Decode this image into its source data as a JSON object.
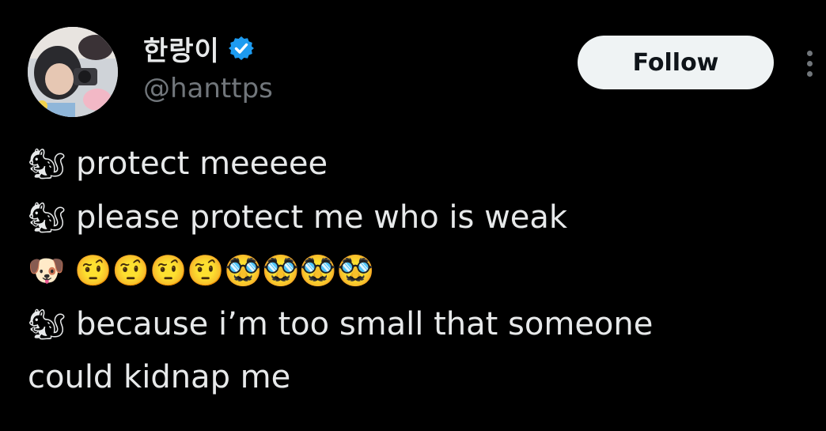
{
  "author": {
    "display_name": "한랑이",
    "handle": "@hanttps",
    "verified": true,
    "verified_color": "#1d9bf0"
  },
  "actions": {
    "follow_label": "Follow",
    "more_icon": "more-vertical-icon"
  },
  "post": {
    "lines": [
      {
        "emoji": "🐿",
        "text": " protect meeeee"
      },
      {
        "emoji": "🐿",
        "text": " please protect me who is weak"
      },
      {
        "emoji": "🐶",
        "text": " 🤨🤨🤨🤨🥸🥸🥸🥸"
      },
      {
        "emoji": "🐿",
        "text": "  because i’m too small that someone"
      },
      {
        "emoji": "",
        "text": "could kidnap me"
      }
    ]
  },
  "colors": {
    "background": "#000000",
    "primary_text": "#e7e9ea",
    "secondary_text": "#71767b",
    "follow_bg": "#eff3f4",
    "follow_text": "#0f1419"
  }
}
